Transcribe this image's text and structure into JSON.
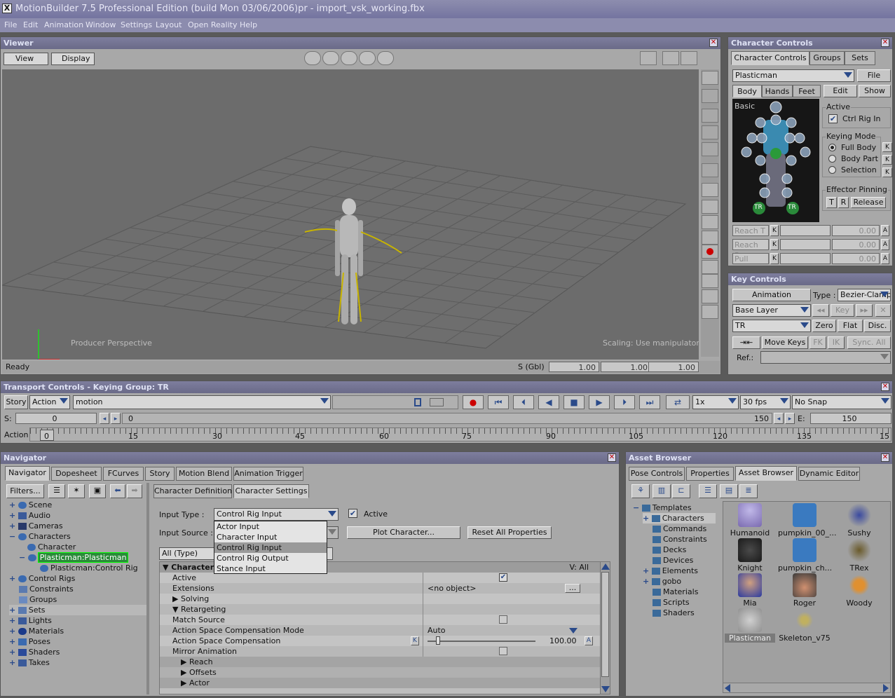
{
  "window": {
    "title": "MotionBuilder 7.5 Professional Edition (build Mon 03/06/2006)pr - import_vsk_working.fbx"
  },
  "menu": [
    "File",
    "Edit",
    "Animation",
    "Window",
    "Settings",
    "Layout",
    "Open Reality",
    "Help"
  ],
  "viewer": {
    "title": "Viewer",
    "view_label": "View",
    "display_label": "Display",
    "camera_label": "Producer Perspective",
    "scaling_label": "Scaling: Use manipulator",
    "status": "Ready",
    "s_gbl": "S (Gbl)",
    "x": "1.00",
    "y": "1.00",
    "z": "1.00"
  },
  "character_controls": {
    "title": "Character Controls",
    "tabs": [
      "Character Controls",
      "Groups",
      "Sets"
    ],
    "character": "Plasticman",
    "file": "File",
    "subtabs": [
      "Body",
      "Hands",
      "Feet"
    ],
    "edit": "Edit",
    "show": "Show",
    "basic": "Basic",
    "active_label": "Active",
    "ctrl_rig_in": "Ctrl Rig In",
    "keying_mode": "Keying Mode",
    "modes": [
      "Full Body",
      "Body Part",
      "Selection"
    ],
    "effector_pinning": "Effector Pinning",
    "pin_t": "T",
    "pin_r": "R",
    "release": "Release",
    "reach_t": "Reach T",
    "reach_r": "Reach R",
    "pull": "Pull",
    "zero": "0.00",
    "k": "K",
    "a": "A",
    "tr": "TR"
  },
  "key_controls": {
    "title": "Key Controls",
    "animation": "Animation",
    "type_label": "Type :",
    "type_value": "Bezier-Clamp",
    "base_layer": "Base Layer",
    "key": "Key",
    "tr": "TR",
    "zero": "Zero",
    "flat": "Flat",
    "disc": "Disc.",
    "move_keys": "Move Keys",
    "fk": "FK",
    "ik": "IK",
    "sync_all": "Sync. All",
    "ref": "Ref.:"
  },
  "transport": {
    "title": "Transport Controls  -  Keying Group: TR",
    "story": "Story",
    "action": "Action",
    "take": "motion",
    "speed": "1x",
    "fps": "30 fps",
    "snap": "No Snap",
    "s_label": "S:",
    "s_value": "0",
    "start": "0",
    "end": "150",
    "e_label": "E:",
    "e_value": "150",
    "action_label": "Action",
    "ticks": [
      "0",
      "15",
      "30",
      "45",
      "60",
      "75",
      "90",
      "105",
      "120",
      "135",
      "15"
    ]
  },
  "navigator": {
    "title": "Navigator",
    "tabs": [
      "Navigator",
      "Dopesheet",
      "FCurves",
      "Story",
      "Motion Blend",
      "Animation Trigger"
    ],
    "filters": "Filters...",
    "tree": [
      "Scene",
      "Audio",
      "Cameras",
      "Characters",
      "Character",
      "Plasticman:Plasticman",
      "Plasticman:Control Rig",
      "Control Rigs",
      "Constraints",
      "Groups",
      "Sets",
      "Lights",
      "Materials",
      "Poses",
      "Shaders",
      "Takes"
    ],
    "subtabs": [
      "Character Definition",
      "Character Settings"
    ],
    "input_type_label": "Input Type :",
    "input_type_value": "Control Rig Input",
    "active_label": "Active",
    "input_source_label": "Input Source :",
    "plot_button": "Plot Character...",
    "reset_button": "Reset All Properties",
    "filter_value": "All (Type)",
    "options": [
      "Actor Input",
      "Character Input",
      "Control Rig Input",
      "Control Rig Output",
      "Stance Input"
    ],
    "props_header": "Character",
    "v_all": "V: All",
    "props": [
      {
        "name": "Active",
        "value": ""
      },
      {
        "name": "Extensions",
        "value": "<no object>"
      },
      {
        "name": "Solving",
        "value": ""
      },
      {
        "name": "Retargeting",
        "value": ""
      },
      {
        "name": "Match Source",
        "value": ""
      },
      {
        "name": "Action Space Compensation Mode",
        "value": "Auto"
      },
      {
        "name": "Action Space Compensation",
        "value": "100.00"
      },
      {
        "name": "Mirror Animation",
        "value": ""
      },
      {
        "name": "Reach",
        "value": ""
      },
      {
        "name": "Offsets",
        "value": ""
      },
      {
        "name": "Actor",
        "value": ""
      }
    ],
    "k": "K",
    "a": "A",
    "ellipsis": "..."
  },
  "asset_browser": {
    "title": "Asset Browser",
    "tabs": [
      "Pose Controls",
      "Properties",
      "Asset Browser",
      "Dynamic Editor"
    ],
    "tree": [
      "Templates",
      "Characters",
      "Commands",
      "Constraints",
      "Decks",
      "Devices",
      "Elements",
      "gobo",
      "Materials",
      "Scripts",
      "Shaders"
    ],
    "assets": [
      "Humanoid",
      "pumpkin_00_...",
      "Sushy",
      "Knight",
      "pumpkin_ch...",
      "TRex",
      "Mia",
      "Roger",
      "Woody",
      "Plasticman",
      "Skeleton_v75"
    ]
  },
  "colors": {
    "panel": "#a8a8a8",
    "title_bar": "#6e6e8c",
    "accent": "#2a4a8a",
    "viewport": "#6a6a6a"
  }
}
